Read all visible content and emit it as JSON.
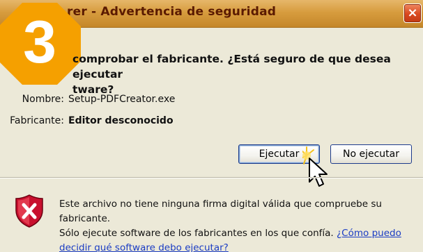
{
  "window": {
    "title": "rer - Advertencia de seguridad",
    "close_glyph": "×"
  },
  "badge": {
    "text": "3",
    "color": "#f5a000"
  },
  "dialog": {
    "heading_line1": "comprobar el fabricante. ¿Está seguro de que desea ejecutar",
    "heading_line2": "tware?",
    "fields": {
      "name_label": "Nombre:",
      "name_value": "Setup-PDFCreator.exe",
      "publisher_label": "Fabricante:",
      "publisher_value": "Editor desconocido"
    },
    "buttons": {
      "run": "Ejecutar",
      "dont_run": "No ejecutar"
    },
    "warning": {
      "line1": "Este archivo no tiene ninguna firma digital válida que compruebe su fabricante.",
      "line2_prefix": "Sólo ejecute software de los fabricantes en los que confía. ",
      "link_part1": "¿Cómo puedo",
      "link_part2": "decidir qué software debo ejecutar?",
      "icon": "shield-x-icon"
    }
  },
  "colors": {
    "title_gradient_top": "#e6b76a",
    "title_text": "#5a1a00",
    "close_red": "#d9481f",
    "dialog_bg": "#ece9d8",
    "link": "#1a3cc4",
    "button_border": "#1c3a8c"
  },
  "icons": [
    "close-icon",
    "shield-x-icon",
    "pointer-cursor-icon"
  ]
}
